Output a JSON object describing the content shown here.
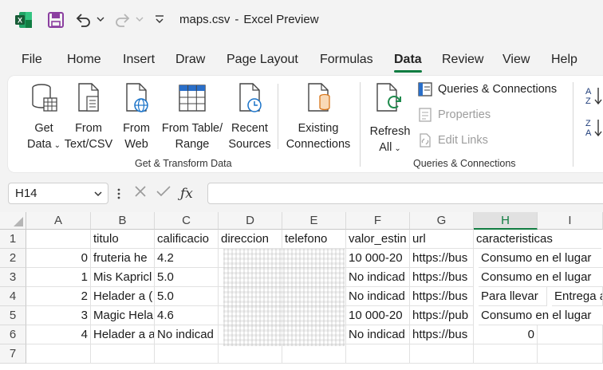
{
  "window": {
    "file_name": "maps.csv",
    "separator": "-",
    "app_name": "Excel Preview"
  },
  "qat": {
    "icons": [
      "excel-logo-icon",
      "save-icon",
      "undo-icon",
      "redo-icon",
      "customize-qat-icon"
    ]
  },
  "tabs": [
    {
      "label": "File"
    },
    {
      "label": "Home"
    },
    {
      "label": "Insert"
    },
    {
      "label": "Draw"
    },
    {
      "label": "Page Layout"
    },
    {
      "label": "Formulas"
    },
    {
      "label": "Data",
      "active": true
    },
    {
      "label": "Review"
    },
    {
      "label": "View"
    },
    {
      "label": "Help"
    }
  ],
  "ribbon": {
    "get_transform": {
      "group_label": "Get & Transform Data",
      "get_data": {
        "line1": "Get",
        "line2": "Data"
      },
      "from_text": {
        "line1": "From",
        "line2": "Text/CSV"
      },
      "from_web": {
        "line1": "From",
        "line2": "Web"
      },
      "from_table": {
        "line1": "From Table/",
        "line2": "Range"
      },
      "recent_sources": {
        "line1": "Recent",
        "line2": "Sources"
      },
      "existing_connections": {
        "line1": "Existing",
        "line2": "Connections"
      }
    },
    "queries": {
      "group_label": "Queries & Connections",
      "refresh_all": {
        "line1": "Refresh",
        "line2": "All"
      },
      "queries_connections": "Queries & Connections",
      "properties": "Properties",
      "edit_links": "Edit Links"
    },
    "sort": {
      "az_label": "A Z",
      "za_label": "Z A"
    }
  },
  "formula_bar": {
    "name_box": "H14",
    "formula": ""
  },
  "grid": {
    "columns": [
      "A",
      "B",
      "C",
      "D",
      "E",
      "F",
      "G",
      "H",
      "I"
    ],
    "selected_column": "H",
    "rows": [
      "1",
      "2",
      "3",
      "4",
      "5",
      "6",
      "7"
    ],
    "header_row": {
      "B": "titulo",
      "C": "calificacio",
      "D": "direccion",
      "E": "telefono",
      "F": "valor_estin",
      "G": "url",
      "H": "caracteristicas"
    },
    "data_rows": [
      {
        "A": "0",
        "B": "fruteria he",
        "C": "4.2",
        "F": "10 000-20",
        "G": "https://bus",
        "H": "Consumo en el lugar"
      },
      {
        "A": "1",
        "B": "Mis Kapricl",
        "C": "5.0",
        "F": "No indicad",
        "G": "https://bus",
        "H": "Consumo en el lugar"
      },
      {
        "A": "2",
        "B": "Helader a (",
        "C": "5.0",
        "F": "No indicad",
        "G": "https://bus",
        "H": "Para llevar",
        "I": "Entrega a"
      },
      {
        "A": "3",
        "B": "Magic Hela",
        "C": "4.6",
        "F": "10 000-20",
        "G": "https://pub",
        "H": "Consumo en el lugar"
      },
      {
        "A": "4",
        "B": "Helader a a",
        "C": "No indicad",
        "F": "No indicad",
        "G": "https://bus",
        "H": "0"
      }
    ]
  },
  "colors": {
    "accent": "#107c41",
    "excel_green": "#1d6f42",
    "save_purple": "#8b3fa0"
  }
}
